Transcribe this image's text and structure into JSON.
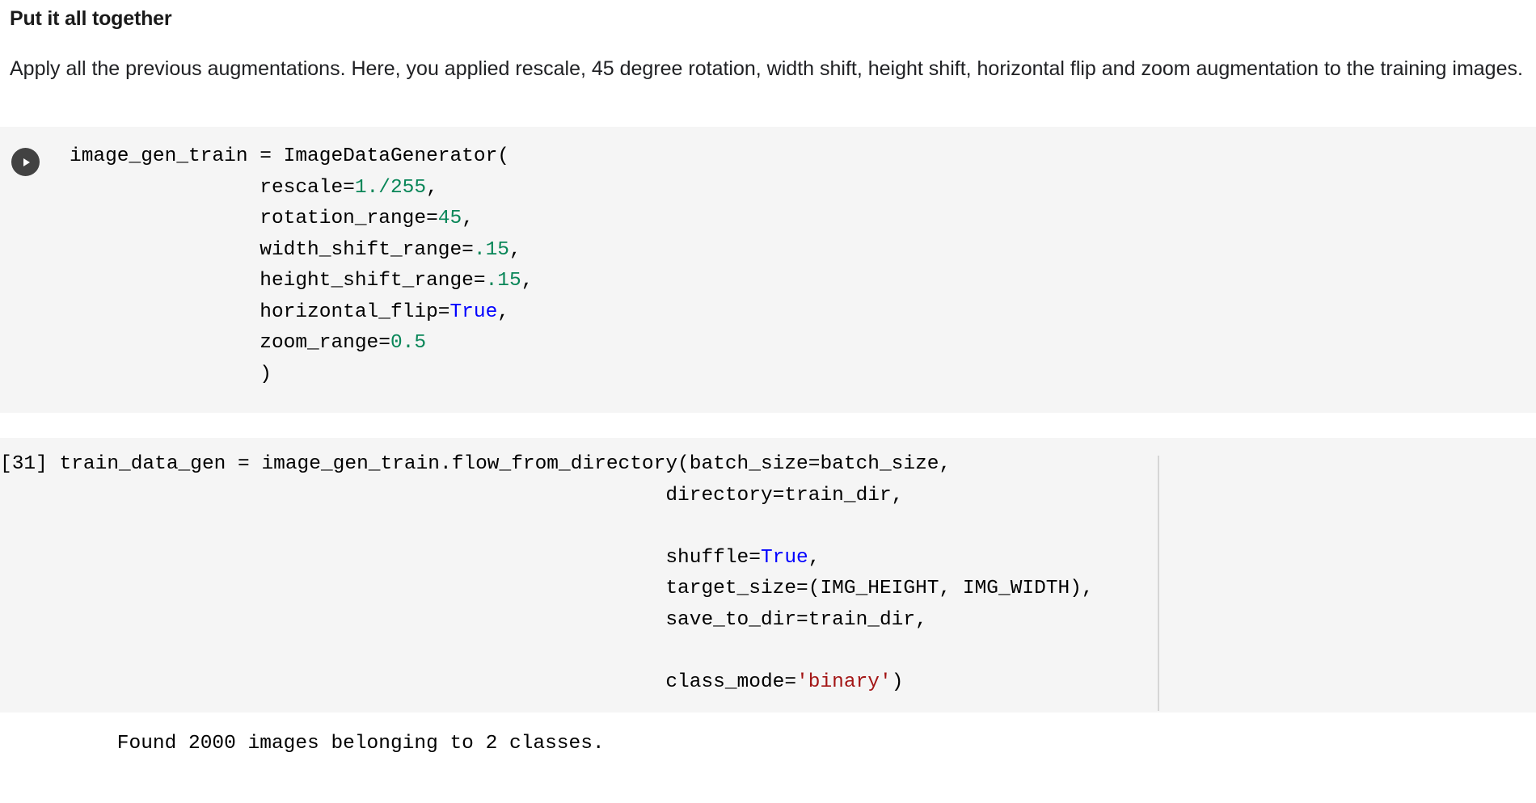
{
  "prose": {
    "heading": "Put it all together",
    "paragraph": "Apply all the previous augmentations. Here, you applied rescale, 45 degree rotation, width shift, height shift, horizontal flip and zoom augmentation to the training images."
  },
  "colors": {
    "cell_background": "#f5f5f5",
    "page_background": "#ffffff",
    "number_token": "#098658",
    "boolean_token": "#0000ff",
    "string_token": "#a31515",
    "run_button": "#424242",
    "divider": "#d6d6d6"
  },
  "cells": [
    {
      "id": "cell-1",
      "execution_label": "",
      "run_button_icon": "play-icon",
      "code_lines": [
        [
          {
            "t": "image_gen_train = ImageDataGenerator(",
            "c": "plain"
          }
        ],
        [
          {
            "t": "                rescale=",
            "c": "plain"
          },
          {
            "t": "1.",
            "c": "num"
          },
          {
            "t": "/",
            "c": "num"
          },
          {
            "t": "255",
            "c": "num"
          },
          {
            "t": ",",
            "c": "plain"
          }
        ],
        [
          {
            "t": "                rotation_range=",
            "c": "plain"
          },
          {
            "t": "45",
            "c": "num"
          },
          {
            "t": ",",
            "c": "plain"
          }
        ],
        [
          {
            "t": "                width_shift_range=",
            "c": "plain"
          },
          {
            "t": ".15",
            "c": "num"
          },
          {
            "t": ",",
            "c": "plain"
          }
        ],
        [
          {
            "t": "                height_shift_range=",
            "c": "plain"
          },
          {
            "t": ".15",
            "c": "num"
          },
          {
            "t": ",",
            "c": "plain"
          }
        ],
        [
          {
            "t": "                horizontal_flip=",
            "c": "plain"
          },
          {
            "t": "True",
            "c": "bool"
          },
          {
            "t": ",",
            "c": "plain"
          }
        ],
        [
          {
            "t": "                zoom_range=",
            "c": "plain"
          },
          {
            "t": "0.5",
            "c": "num"
          }
        ],
        [
          {
            "t": "                )",
            "c": "plain"
          }
        ]
      ]
    },
    {
      "id": "cell-2",
      "execution_label": "[31]",
      "has_divider": true,
      "code_lines": [
        [
          {
            "t": "[31] train_data_gen = image_gen_train.flow_from_directory(batch_size=batch_size,",
            "c": "plain"
          }
        ],
        [
          {
            "t": "                                                        directory=train_dir,",
            "c": "plain"
          }
        ],
        [
          {
            "t": "",
            "c": "plain"
          }
        ],
        [
          {
            "t": "                                                        shuffle=",
            "c": "plain"
          },
          {
            "t": "True",
            "c": "bool"
          },
          {
            "t": ",",
            "c": "plain"
          }
        ],
        [
          {
            "t": "                                                        target_size=(IMG_HEIGHT, IMG_WIDTH),",
            "c": "plain"
          }
        ],
        [
          {
            "t": "                                                        save_to_dir=train_dir,",
            "c": "plain"
          }
        ],
        [
          {
            "t": "",
            "c": "plain"
          }
        ],
        [
          {
            "t": "                                                        class_mode=",
            "c": "plain"
          },
          {
            "t": "'binary'",
            "c": "str"
          },
          {
            "t": ")",
            "c": "plain"
          }
        ]
      ]
    }
  ],
  "output": {
    "text": "    Found 2000 images belonging to 2 classes."
  }
}
